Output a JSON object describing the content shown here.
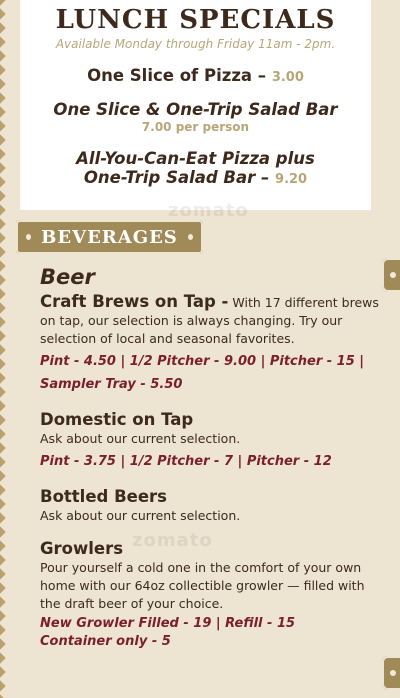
{
  "specials": {
    "title": "LUNCH SPECIALS",
    "availability": "Available Monday through Friday 11am - 2pm.",
    "item1_name": "One Slice of Pizza –",
    "item1_price": "3.00",
    "item2_name": "One Slice & One-Trip Salad Bar",
    "item2_price": "7.00 per person",
    "item3_line1": "All-You-Can-Eat Pizza plus",
    "item3_line2": "One-Trip Salad Bar –",
    "item3_price": "9.20"
  },
  "beverages": {
    "banner_label": "BEVERAGES",
    "category": "Beer",
    "craft_title": "Craft Brews on Tap -",
    "craft_desc": "With 17 different brews on tap, our selection is always changing. Try our selection of local and seasonal favorites.",
    "craft_prices_line1": "Pint - 4.50 | 1/2 Pitcher - 9.00 | Pitcher - 15 |",
    "craft_prices_line2": "Sampler Tray - 5.50",
    "domestic_title": "Domestic on Tap",
    "domestic_desc": "Ask about our current selection.",
    "domestic_prices": "Pint - 3.75 | 1/2 Pitcher - 7 | Pitcher - 12",
    "bottled_title": "Bottled Beers",
    "bottled_desc": "Ask about our current selection.",
    "growlers_title": "Growlers",
    "growlers_desc": "Pour yourself a cold one in the comfort of your own home with our 64oz collectible growler — filled with the draft beer of your choice.",
    "growlers_prices_line1": "New Growler Filled - 19 | Refill - 15",
    "growlers_prices_line2": "Container only - 5"
  },
  "watermark_text": "zomato",
  "colors": {
    "background": "#ede4d2",
    "heading": "#3d2a1c",
    "gold": "#b8a679",
    "banner": "#a08a58",
    "price": "#7a1f2b"
  }
}
